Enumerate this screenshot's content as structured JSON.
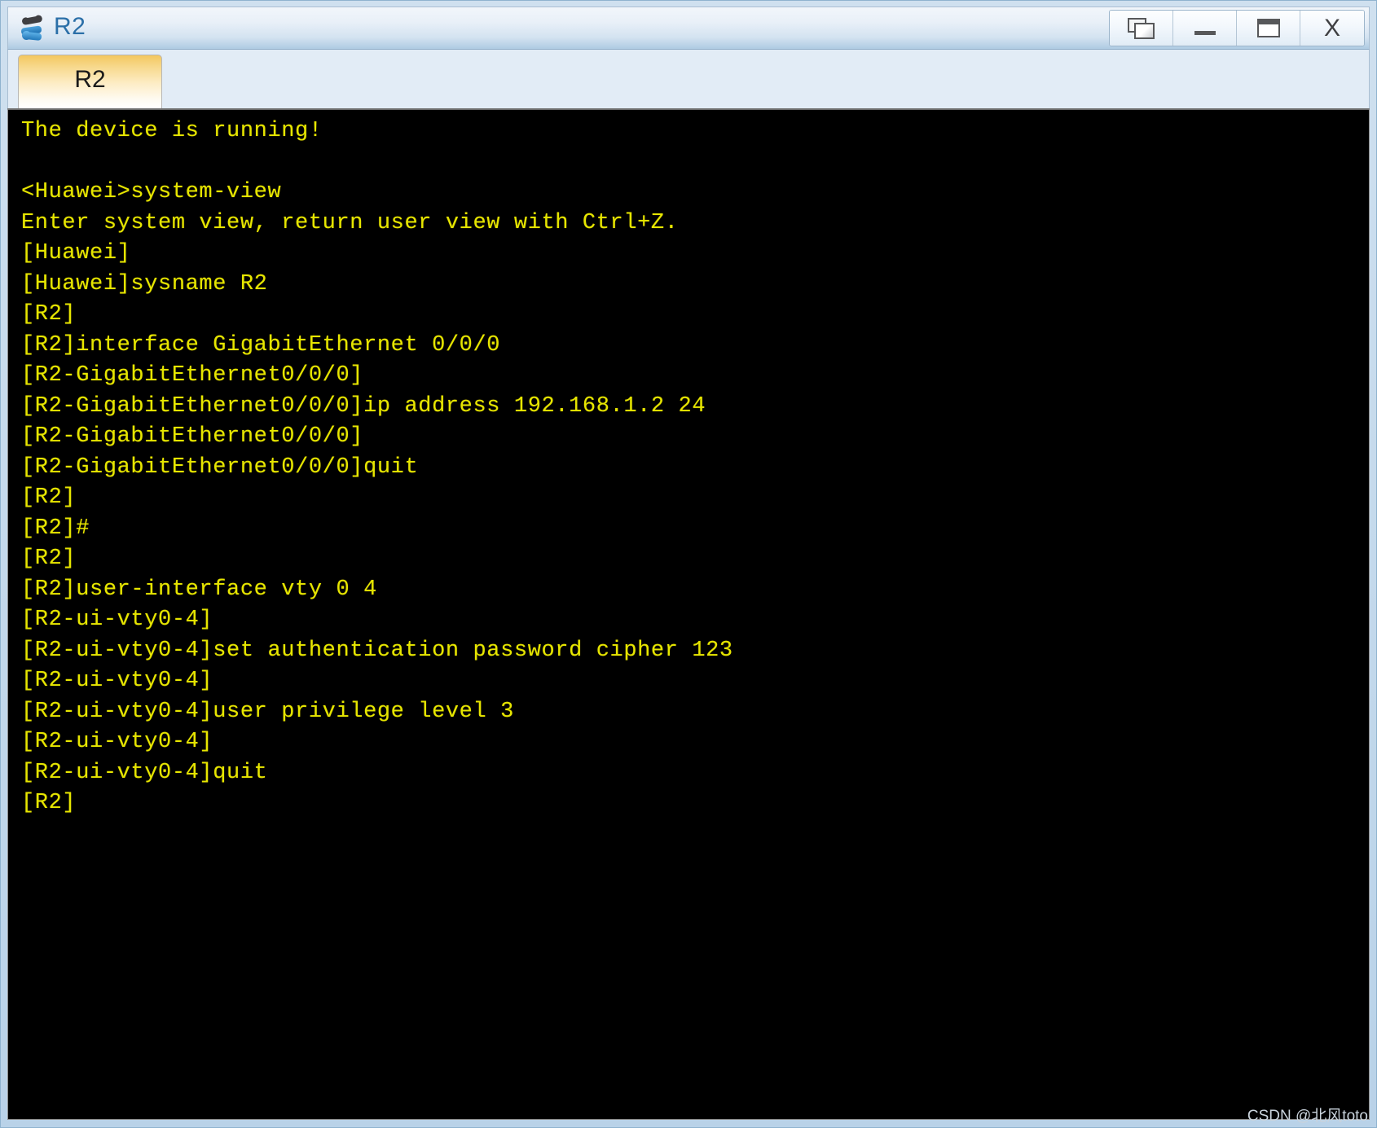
{
  "window": {
    "title": "R2",
    "app_icon": "router-icon",
    "buttons": [
      {
        "name": "restore-button",
        "icon": "restore-windows-icon",
        "label": ""
      },
      {
        "name": "minimize-button",
        "icon": "minimize-icon",
        "label": ""
      },
      {
        "name": "maximize-button",
        "icon": "maximize-icon",
        "label": ""
      },
      {
        "name": "close-button",
        "icon": "close-icon",
        "label": "X"
      }
    ]
  },
  "tabs": [
    {
      "label": "R2",
      "active": true
    }
  ],
  "terminal": {
    "foreground": "#e6e600",
    "background": "#000000",
    "lines": [
      "The device is running!",
      "",
      "<Huawei>system-view",
      "Enter system view, return user view with Ctrl+Z.",
      "[Huawei]",
      "[Huawei]sysname R2",
      "[R2]",
      "[R2]interface GigabitEthernet 0/0/0",
      "[R2-GigabitEthernet0/0/0]",
      "[R2-GigabitEthernet0/0/0]ip address 192.168.1.2 24",
      "[R2-GigabitEthernet0/0/0]",
      "[R2-GigabitEthernet0/0/0]quit",
      "[R2]",
      "[R2]#",
      "[R2]",
      "[R2]user-interface vty 0 4",
      "[R2-ui-vty0-4]",
      "[R2-ui-vty0-4]set authentication password cipher 123",
      "[R2-ui-vty0-4]",
      "[R2-ui-vty0-4]user privilege level 3",
      "[R2-ui-vty0-4]",
      "[R2-ui-vty0-4]quit",
      "[R2]"
    ]
  },
  "watermark": {
    "text": "CSDN @北风toto"
  }
}
